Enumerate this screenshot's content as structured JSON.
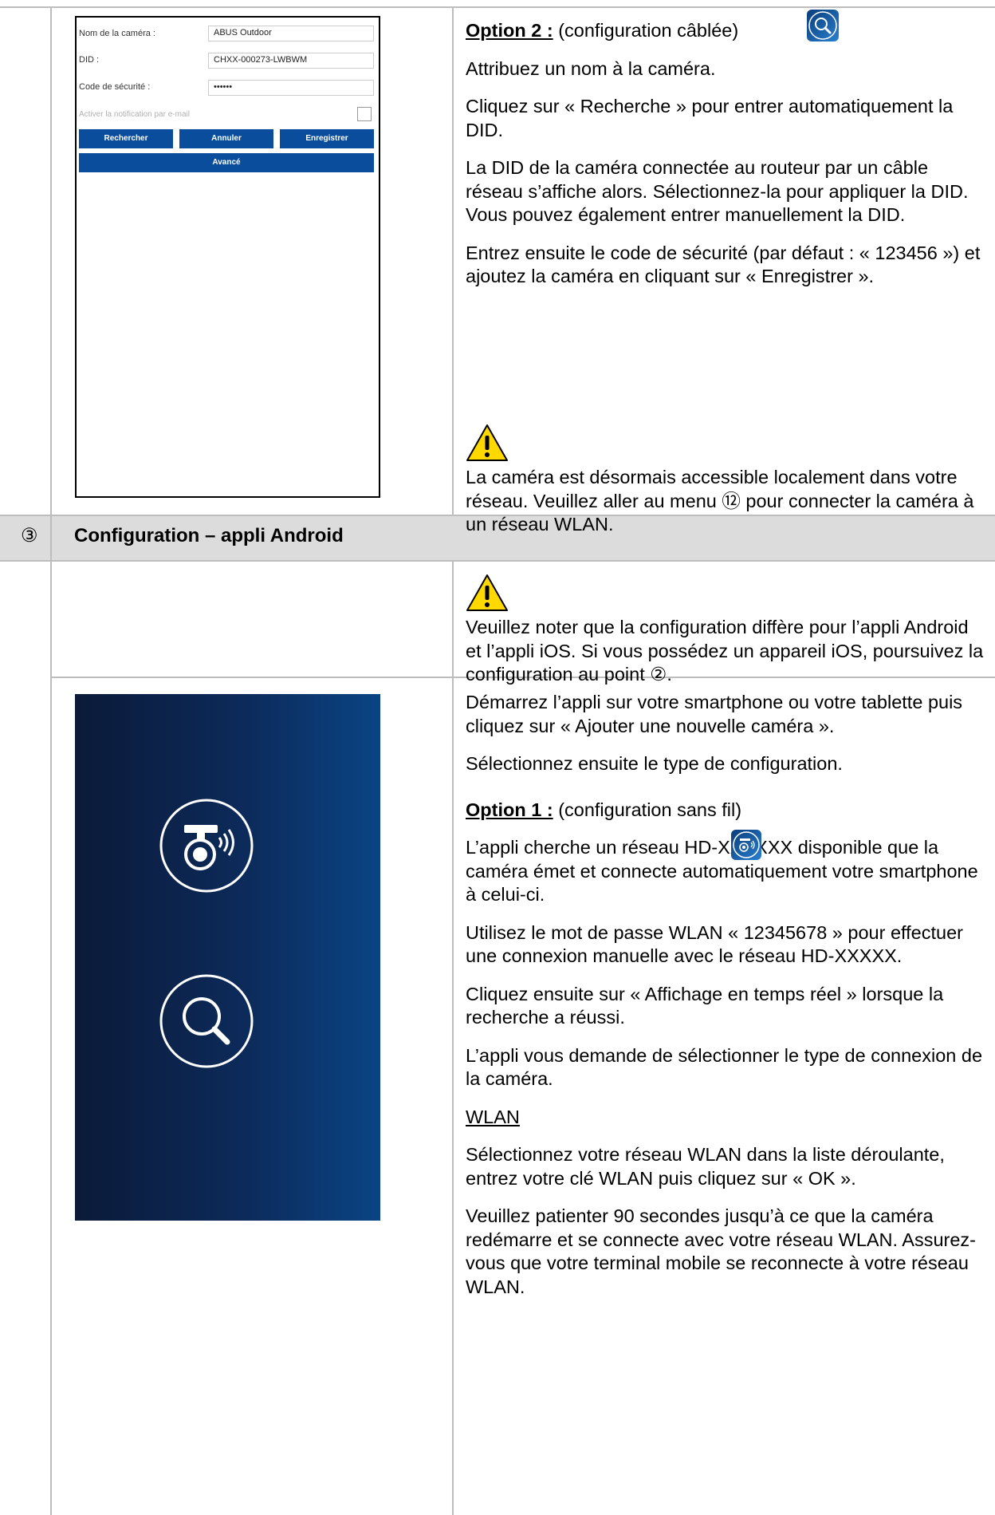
{
  "phone_form": {
    "camera_name_label": "Nom de la caméra :",
    "camera_name_value": "ABUS Outdoor",
    "did_label": "DID :",
    "did_value": "CHXX-000273-LWBWM",
    "security_label": "Code de sécurité :",
    "security_value": "••••••",
    "email_notification_label": "Activer la notification par e-mail",
    "search_button": "Rechercher",
    "cancel_button": "Annuler",
    "save_button": "Enregistrer",
    "advanced_button": "Avancé"
  },
  "option2": {
    "title": "Option 2 :",
    "subtitle": "(configuration câblée)",
    "p1": "Attribuez un nom à la caméra.",
    "p2": "Cliquez sur « Recherche » pour entrer automatiquement la DID.",
    "p3": "La DID de la caméra connectée au routeur par un câble réseau s’affiche alors. Sélectionnez-la pour appliquer la DID. Vous pouvez également entrer manuellement la DID.",
    "p4": "Entrez ensuite le code de sécurité (par défaut : « 123456 ») et ajoutez la caméra en cliquant sur « Enregistrer ».",
    "p5": "La caméra est désormais accessible localement dans votre réseau. Veuillez aller au menu ⑫ pour connecter la caméra à un réseau WLAN."
  },
  "section3": {
    "number": "③",
    "title": "Configuration – appli Android"
  },
  "note": {
    "text": "Veuillez noter que la configuration diffère pour l’appli Android et l’appli iOS. Si vous possédez un appareil iOS, poursuivez la configuration au point ②."
  },
  "android": {
    "p1": "Démarrez l’appli sur votre smartphone ou votre tablette puis cliquez sur « Ajouter une nouvelle caméra ».",
    "p2": "Sélectionnez ensuite le type de configuration.",
    "option1_title": "Option 1 :",
    "option1_subtitle": "(configuration sans fil)",
    "p3": "L’appli cherche un réseau HD-XXXXXX disponible que la caméra émet et connecte automatiquement votre smartphone à celui-ci.",
    "p4": "Utilisez le mot de passe WLAN « 12345678 » pour effectuer une connexion manuelle avec le réseau HD-XXXXX.",
    "p5": "Cliquez ensuite sur « Affichage en temps réel » lorsque la recherche a réussi.",
    "p6": "L’appli vous demande de sélectionner le type de connexion de la caméra.",
    "wlan_heading": "WLAN",
    "p7": "Sélectionnez votre réseau WLAN dans la liste déroulante, entrez votre clé WLAN puis cliquez sur « OK ».",
    "p8": "Veuillez patienter 90 secondes jusqu’à ce que la caméra redémarre et se connecte avec votre réseau WLAN. Assurez-vous que votre terminal mobile se reconnecte à votre réseau WLAN."
  }
}
